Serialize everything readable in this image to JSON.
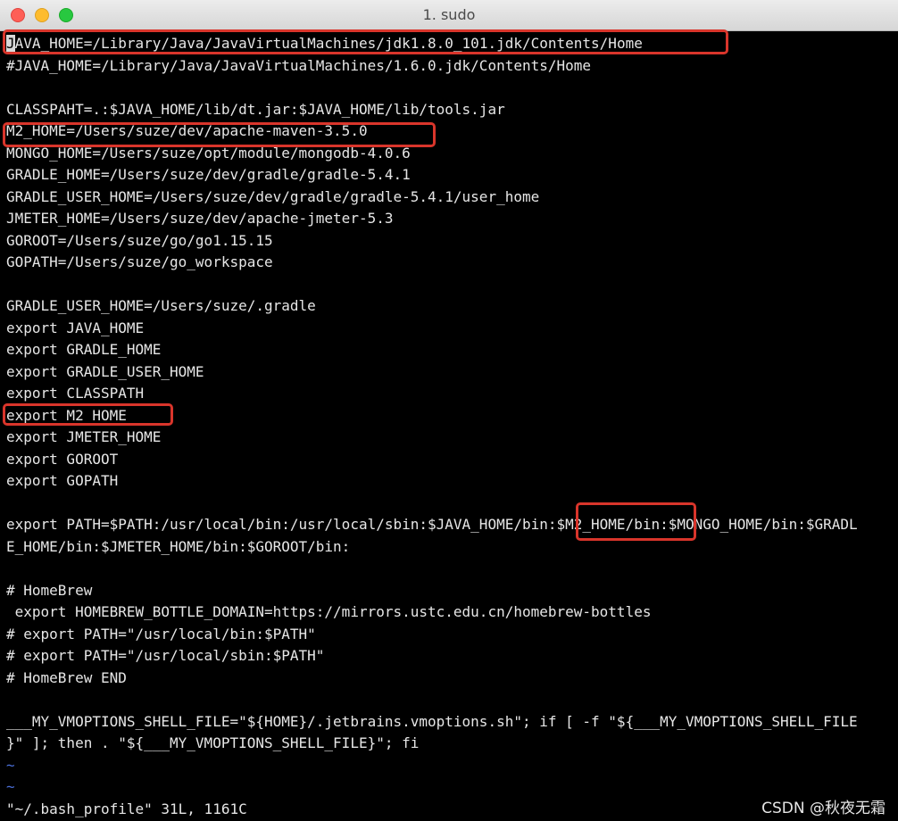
{
  "window": {
    "title": "1. sudo"
  },
  "colors": {
    "background": "#000000",
    "text": "#e6e6e6",
    "tilde": "#4a6fd8",
    "highlight_box": "#d9352b"
  },
  "editor": {
    "cursor_char": "J",
    "lines": [
      "JAVA_HOME=/Library/Java/JavaVirtualMachines/jdk1.8.0_101.jdk/Contents/Home",
      "#JAVA_HOME=/Library/Java/JavaVirtualMachines/1.6.0.jdk/Contents/Home",
      "",
      "CLASSPAHT=.:$JAVA_HOME/lib/dt.jar:$JAVA_HOME/lib/tools.jar",
      "M2_HOME=/Users/suze/dev/apache-maven-3.5.0",
      "MONGO_HOME=/Users/suze/opt/module/mongodb-4.0.6",
      "GRADLE_HOME=/Users/suze/dev/gradle/gradle-5.4.1",
      "GRADLE_USER_HOME=/Users/suze/dev/gradle/gradle-5.4.1/user_home",
      "JMETER_HOME=/Users/suze/dev/apache-jmeter-5.3",
      "GOROOT=/Users/suze/go/go1.15.15",
      "GOPATH=/Users/suze/go_workspace",
      "",
      "GRADLE_USER_HOME=/Users/suze/.gradle",
      "export JAVA_HOME",
      "export GRADLE_HOME",
      "export GRADLE_USER_HOME",
      "export CLASSPATH",
      "export M2_HOME",
      "export JMETER_HOME",
      "export GOROOT",
      "export GOPATH",
      "",
      "export PATH=$PATH:/usr/local/bin:/usr/local/sbin:$JAVA_HOME/bin:$M2_HOME/bin:$MONGO_HOME/bin:$GRADL",
      "E_HOME/bin:$JMETER_HOME/bin:$GOROOT/bin:",
      "",
      "# HomeBrew",
      " export HOMEBREW_BOTTLE_DOMAIN=https://mirrors.ustc.edu.cn/homebrew-bottles",
      "# export PATH=\"/usr/local/bin:$PATH\"",
      "# export PATH=\"/usr/local/sbin:$PATH\"",
      "# HomeBrew END",
      "",
      "___MY_VMOPTIONS_SHELL_FILE=\"${HOME}/.jetbrains.vmoptions.sh\"; if [ -f \"${___MY_VMOPTIONS_SHELL_FILE",
      "}\" ]; then . \"${___MY_VMOPTIONS_SHELL_FILE}\"; fi",
      "~",
      "~"
    ],
    "status_line": "\"~/.bash_profile\" 31L, 1161C"
  },
  "watermark": "CSDN @秋夜无霜"
}
